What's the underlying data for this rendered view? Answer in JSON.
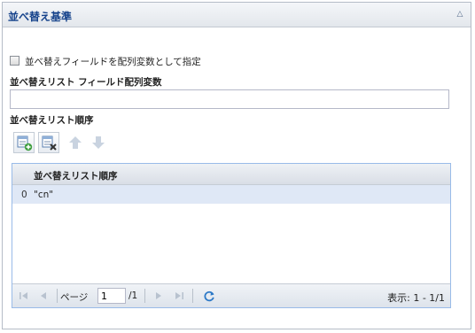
{
  "panel": {
    "title": "並べ替え基準",
    "collapse_icon": "chevron-up-icon"
  },
  "checkbox": {
    "label": "並べ替えフィールドを配列変数として指定",
    "checked": false
  },
  "list_field": {
    "label": "並べ替えリスト フィールド配列変数",
    "value": ""
  },
  "order": {
    "label": "並べ替えリスト順序",
    "toolbar": {
      "add_icon": "add-row-icon",
      "delete_icon": "delete-row-icon",
      "up_icon": "arrow-up-icon",
      "down_icon": "arrow-down-icon"
    }
  },
  "grid": {
    "column_header": "並べ替えリスト順序",
    "rows": [
      {
        "index": "0",
        "value": "\"cn\""
      }
    ]
  },
  "pager": {
    "page_label": "ページ",
    "page_value": "1",
    "total_pages": "/1",
    "display_info": "表示: 1 - 1/1",
    "icons": [
      "first-page-icon",
      "prev-page-icon",
      "next-page-icon",
      "last-page-icon",
      "refresh-icon"
    ]
  },
  "colors": {
    "title": "#15428b",
    "selected_row": "#dfe8f6",
    "grid_border": "#99bbe8"
  }
}
